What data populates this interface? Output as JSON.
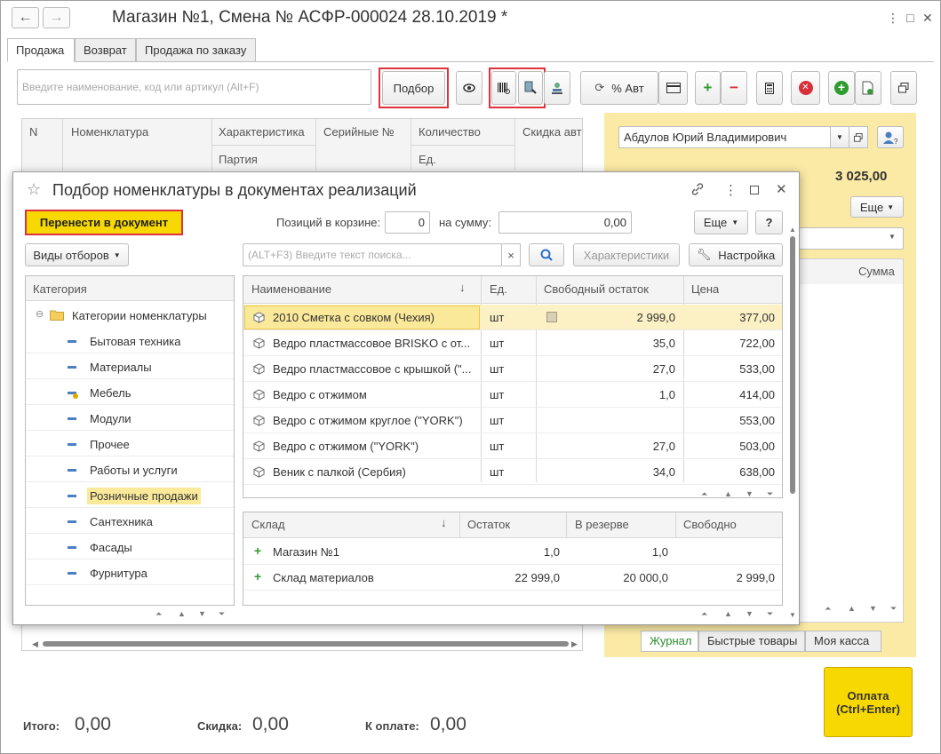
{
  "window": {
    "title": "Магазин №1, Смена № АСФР-000024  28.10.2019 *",
    "back_arrow": "←",
    "forward_arrow": "→",
    "more": "⋮",
    "maximize": "□",
    "close": "✕"
  },
  "tabs": [
    {
      "label": "Продажа"
    },
    {
      "label": "Возврат"
    },
    {
      "label": "Продажа по заказу"
    }
  ],
  "toolbar": {
    "search_placeholder": "Введите наименование, код или артикул (Alt+F)",
    "podbor_label": "Подбор",
    "discount_label": "% Авт",
    "plus": "+",
    "minus": "−",
    "delete": "✕"
  },
  "main_grid": {
    "columns": [
      "N",
      "Номенклатура",
      "Характеристика",
      "Серийные №",
      "Количество",
      "Скидка авт"
    ],
    "sub_columns": [
      "Партия",
      "Ед."
    ]
  },
  "right_panel": {
    "cashier": "Абдулов Юрий Владимирович",
    "total": "3 025,00",
    "more_label": "Еще",
    "sum_col": "Сумма",
    "tabs": [
      "Журнал",
      "Быстрые товары",
      "Моя касса"
    ]
  },
  "pay_button": {
    "line1": "Оплата",
    "line2": "(Ctrl+Enter)"
  },
  "footer": {
    "total_label": "Итого:",
    "total_value": "0,00",
    "discount_label": "Скидка:",
    "discount_value": "0,00",
    "to_pay_label": "К оплате:",
    "to_pay_value": "0,00"
  },
  "dialog": {
    "title": "Подбор номенклатуры в документах реализаций",
    "transfer_label": "Перенести в документ",
    "positions_label": "Позиций в корзине:",
    "positions_value": "0",
    "sum_label": "на сумму:",
    "sum_value": "0,00",
    "more_label": "Еще",
    "help_label": "?",
    "filter_kinds_label": "Виды отборов",
    "search_placeholder": "(ALT+F3) Введите текст поиска...",
    "characteristics_label": "Характеристики",
    "settings_label": "Настройка",
    "clear": "×",
    "category": {
      "header": "Категория",
      "root": "Категории номенклатуры",
      "items": [
        "Бытовая техника",
        "Материалы",
        "Мебель",
        "Модули",
        "Прочее",
        "Работы и услуги",
        "Розничные продажи",
        "Сантехника",
        "Фасады",
        "Фурнитура"
      ]
    },
    "products": {
      "columns": [
        "Наименование",
        "Ед.",
        "Свободный остаток",
        "Цена"
      ],
      "sort_arrow": "↓",
      "rows": [
        {
          "name": "2010 Сметка с совком (Чехия)",
          "unit": "шт",
          "free": "2 999,0",
          "price": "377,00"
        },
        {
          "name": "Ведро пластмассовое BRISKO с от...",
          "unit": "шт",
          "free": "35,0",
          "price": "722,00"
        },
        {
          "name": "Ведро пластмассовое с крышкой (\"...",
          "unit": "шт",
          "free": "27,0",
          "price": "533,00"
        },
        {
          "name": "Ведро с отжимом",
          "unit": "шт",
          "free": "1,0",
          "price": "414,00"
        },
        {
          "name": "Ведро с отжимом  круглое (\"YORK\")",
          "unit": "шт",
          "free": "",
          "price": "553,00"
        },
        {
          "name": "Ведро с отжимом (\"YORK\")",
          "unit": "шт",
          "free": "27,0",
          "price": "503,00"
        },
        {
          "name": "Веник с палкой (Сербия)",
          "unit": "шт",
          "free": "34,0",
          "price": "638,00"
        }
      ]
    },
    "warehouses": {
      "columns": [
        "Склад",
        "Остаток",
        "В резерве",
        "Свободно"
      ],
      "sort_arrow": "↓",
      "rows": [
        {
          "name": "Магазин №1",
          "stock": "1,0",
          "reserve": "1,0",
          "free": ""
        },
        {
          "name": "Склад материалов",
          "stock": "22 999,0",
          "reserve": "20 000,0",
          "free": "2 999,0"
        }
      ]
    }
  }
}
